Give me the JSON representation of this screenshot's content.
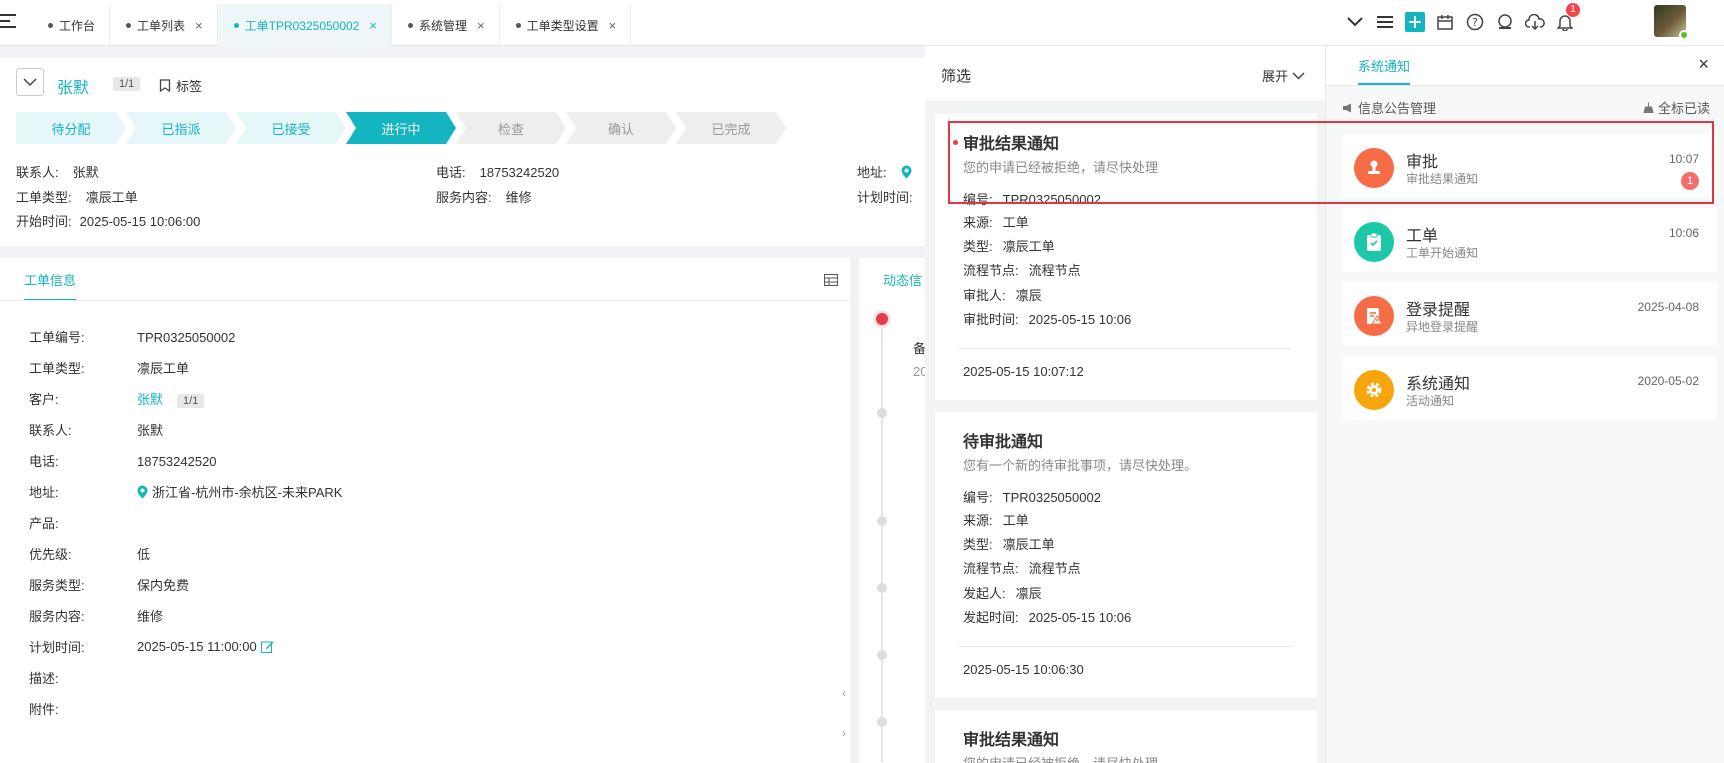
{
  "tabs": [
    {
      "label": "工作台",
      "closable": false
    },
    {
      "label": "工单列表",
      "closable": true
    },
    {
      "label": "工单TPR0325050002",
      "closable": true,
      "active": true
    },
    {
      "label": "系统管理",
      "closable": true
    },
    {
      "label": "工单类型设置",
      "closable": true
    }
  ],
  "topbar": {
    "notification_count": "1"
  },
  "header": {
    "customer_name": "张默",
    "page_indicator": "1/1",
    "tag_label": "标签",
    "steps": [
      {
        "label": "待分配",
        "state": "done"
      },
      {
        "label": "已指派",
        "state": "done"
      },
      {
        "label": "已接受",
        "state": "done"
      },
      {
        "label": "进行中",
        "state": "current"
      },
      {
        "label": "检查",
        "state": "todo"
      },
      {
        "label": "确认",
        "state": "todo"
      },
      {
        "label": "已完成",
        "state": "todo"
      }
    ],
    "contact_key": "联系人:",
    "contact_val": "张默",
    "phone_key": "电话:",
    "phone_val": "18753242520",
    "address_key": "地址:",
    "type_key": "工单类型:",
    "type_val": "凛辰工单",
    "service_key": "服务内容:",
    "service_val": "维修",
    "plan_key": "计划时间:",
    "start_key": "开始时间:",
    "start_val": "2025-05-15 10:06:00"
  },
  "info": {
    "tab_label": "工单信息",
    "fields": {
      "no_k": "工单编号:",
      "no_v": "TPR0325050002",
      "type_k": "工单类型:",
      "type_v": "凛辰工单",
      "cust_k": "客户:",
      "cust_v": "张默",
      "cust_page": "1/1",
      "contact_k": "联系人:",
      "contact_v": "张默",
      "phone_k": "电话:",
      "phone_v": "18753242520",
      "addr_k": "地址:",
      "addr_v": "浙江省-杭州市-余杭区-未来PARK",
      "product_k": "产品:",
      "priority_k": "优先级:",
      "priority_v": "低",
      "svctype_k": "服务类型:",
      "svctype_v": "保内免费",
      "svc_k": "服务内容:",
      "svc_v": "维修",
      "plan_k": "计划时间:",
      "plan_v": "2025-05-15 11:00:00",
      "desc_k": "描述:",
      "attach_k": "附件:"
    }
  },
  "timeline": {
    "tab_label": "动态信",
    "first_row": "备",
    "second_row": "20"
  },
  "filter": {
    "title": "筛选",
    "expand": "展开",
    "cards": [
      {
        "title": "审批结果通知",
        "desc": "您的申请已经被拒绝，请尽快处理",
        "rows": [
          {
            "k": "编号:",
            "v": "TPR0325050002"
          },
          {
            "k": "来源:",
            "v": "工单"
          },
          {
            "k": "类型:",
            "v": "凛辰工单"
          },
          {
            "k": "流程节点:",
            "v": "流程节点"
          },
          {
            "k": "审批人:",
            "v": "凛辰"
          },
          {
            "k": "审批时间:",
            "v": "2025-05-15 10:06"
          }
        ],
        "time": "2025-05-15 10:07:12"
      },
      {
        "title": "待审批通知",
        "desc": "您有一个新的待审批事项，请尽快处理。",
        "rows": [
          {
            "k": "编号:",
            "v": "TPR0325050002"
          },
          {
            "k": "来源:",
            "v": "工单"
          },
          {
            "k": "类型:",
            "v": "凛辰工单"
          },
          {
            "k": "流程节点:",
            "v": "流程节点"
          },
          {
            "k": "发起人:",
            "v": "凛辰"
          },
          {
            "k": "发起时间:",
            "v": "2025-05-15 10:06"
          }
        ],
        "time": "2025-05-15 10:06:30"
      },
      {
        "title": "审批结果通知",
        "desc": "您的申请已经被拒绝，请尽快处理"
      }
    ]
  },
  "system": {
    "tab_label": "系统通知",
    "close": "×",
    "section_label": "信息公告管理",
    "mark_all": "全标已读",
    "items": [
      {
        "title": "审批",
        "subtitle": "审批结果通知",
        "time": "10:07",
        "count": "1",
        "color": "#f56c47",
        "icon": "stamp-icon"
      },
      {
        "title": "工单",
        "subtitle": "工单开始通知",
        "time": "10:06",
        "color": "#1cc8a8",
        "icon": "clipboard-icon"
      },
      {
        "title": "登录提醒",
        "subtitle": "异地登录提醒",
        "time": "2025-04-08",
        "color": "#f56c47",
        "icon": "login-alert-icon"
      },
      {
        "title": "系统通知",
        "subtitle": "活动通知",
        "time": "2020-05-02",
        "color": "#f7a50c",
        "icon": "gear-icon"
      }
    ]
  }
}
